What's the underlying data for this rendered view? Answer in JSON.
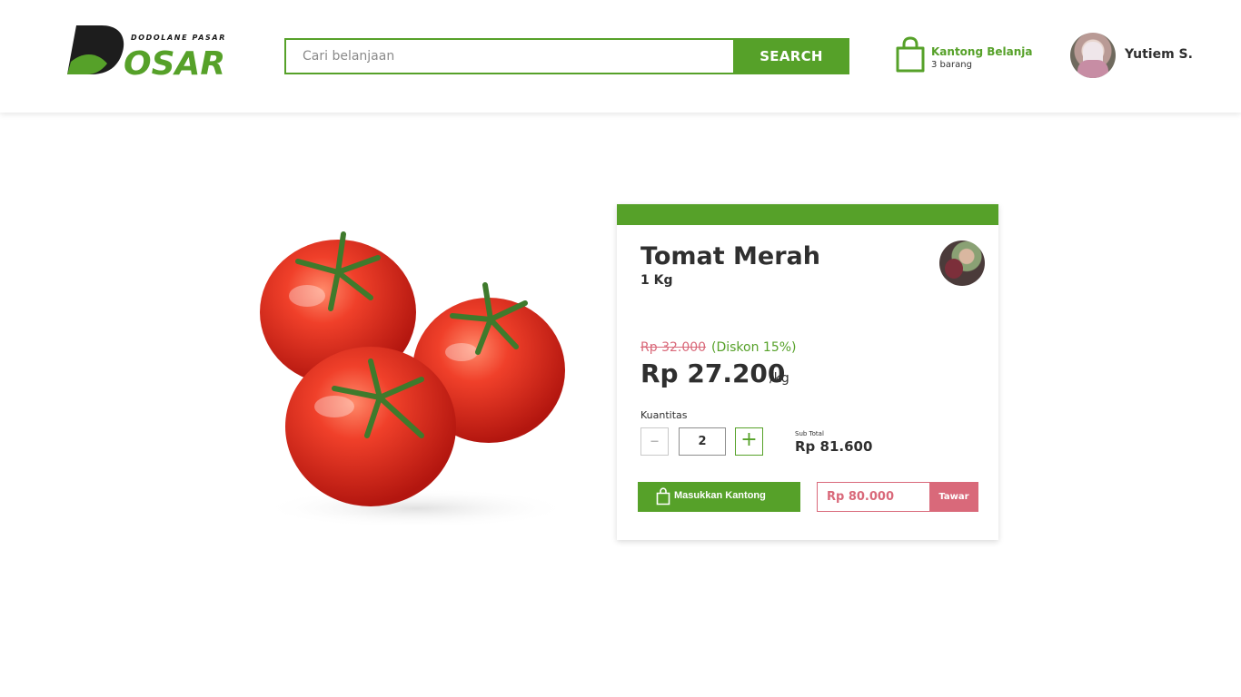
{
  "header": {
    "logo": {
      "name": "DOSAR",
      "tagline": "DODOLANE PASAR",
      "icon": "dosar-logo"
    },
    "search": {
      "placeholder": "Cari belanjaan",
      "value": "",
      "button_label": "SEARCH",
      "icon": "search-button"
    },
    "cart": {
      "title": "Kantong Belanja",
      "count": "3 barang",
      "icon": "shopping-bag-icon"
    },
    "user": {
      "name": "Yutiem S.",
      "icon": "user-avatar"
    }
  },
  "product": {
    "image": "tomato-image",
    "name": "Tomat Merah",
    "unit": "1 Kg",
    "seller_icon": "seller-avatar",
    "old_price": "Rp 32.000",
    "discount": "(Diskon 15%)",
    "price": "Rp 27.200",
    "price_unit": "/kg",
    "quantity": {
      "label": "Kuantitas",
      "minus": "–",
      "value": "2",
      "plus": "+"
    },
    "subtotal": {
      "label": "Sub Total",
      "value": "Rp 81.600"
    },
    "add_button": {
      "label": "Masukkan Kantong",
      "icon": "shopping-bag-icon"
    },
    "offer": {
      "value": "Rp 80.000",
      "button_label": "Tawar"
    }
  },
  "colors": {
    "primary": "#56a129",
    "danger": "#d9697a",
    "text": "#2f2f2f"
  }
}
